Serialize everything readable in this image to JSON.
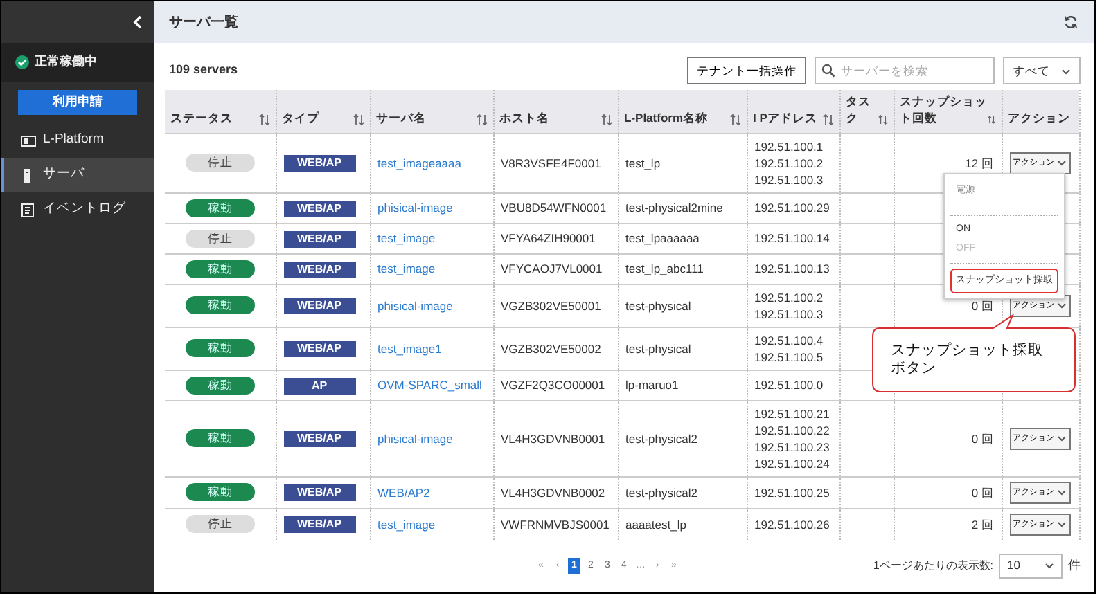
{
  "sidebar": {
    "status": {
      "label": "正常稼働中"
    },
    "request_button": "利用申請",
    "items": [
      {
        "label": "L-Platform",
        "kind": "platform",
        "selected": false
      },
      {
        "label": "サーバ",
        "kind": "server",
        "selected": true
      },
      {
        "label": "イベントログ",
        "kind": "log",
        "selected": false
      }
    ]
  },
  "header": {
    "title": "サーバ一覧"
  },
  "toolbar": {
    "count": "109 servers",
    "bulk_button": "テナント一括操作",
    "search": {
      "placeholder": "サーバーを検索"
    },
    "filter": "すべて"
  },
  "table": {
    "columns": [
      {
        "label": "ステータス",
        "sortable": true
      },
      {
        "label": "タイプ",
        "sortable": true
      },
      {
        "label": "サーバ名",
        "sortable": true
      },
      {
        "label": "ホスト名",
        "sortable": true
      },
      {
        "label": "L-Platform名称",
        "sortable": true
      },
      {
        "label": "I Pアドレス",
        "sortable": true
      },
      {
        "label": "タスク",
        "sortable": true
      },
      {
        "label": "スナップショット回数",
        "sortable": true
      },
      {
        "label": "アクション",
        "sortable": false
      }
    ],
    "rows": [
      {
        "status": {
          "label": "停止",
          "kind": "stopped"
        },
        "type": "WEB/AP",
        "server": "test_imageaaaa",
        "host": "V8R3VSFE4F0001",
        "lplatform": "test_lp",
        "ips": [
          "192.51.100.1",
          "192.51.100.2",
          "192.51.100.3"
        ],
        "snapshots": "12 回",
        "action": "アクション"
      },
      {
        "status": {
          "label": "稼動",
          "kind": "running"
        },
        "type": "WEB/AP",
        "server": "phisical-image",
        "host": "VBU8D54WFN0001",
        "lplatform": "test-physical2mine",
        "ips": [
          "192.51.100.29"
        ]
      },
      {
        "status": {
          "label": "停止",
          "kind": "stopped"
        },
        "type": "WEB/AP",
        "server": "test_image",
        "host": "VFYA64ZIH90001",
        "lplatform": "test_lpaaaaaa",
        "ips": [
          "192.51.100.14"
        ]
      },
      {
        "status": {
          "label": "稼動",
          "kind": "running"
        },
        "type": "WEB/AP",
        "server": "test_image",
        "host": "VFYCAOJ7VL0001",
        "lplatform": "test_lp_abc111",
        "ips": [
          "192.51.100.13"
        ]
      },
      {
        "status": {
          "label": "稼動",
          "kind": "running"
        },
        "type": "WEB/AP",
        "server": "phisical-image",
        "host": "VGZB302VE50001",
        "lplatform": "test-physical",
        "ips": [
          "192.51.100.2",
          "192.51.100.3"
        ],
        "snapshots": "0 回",
        "action": "アクション"
      },
      {
        "status": {
          "label": "稼動",
          "kind": "running"
        },
        "type": "WEB/AP",
        "server": "test_image1",
        "host": "VGZB302VE50002",
        "lplatform": "test-physical",
        "ips": [
          "192.51.100.4",
          "192.51.100.5"
        ]
      },
      {
        "status": {
          "label": "稼動",
          "kind": "running"
        },
        "type": "AP",
        "server": "OVM-SPARC_small",
        "host": "VGZF2Q3CO00001",
        "lplatform": "lp-maruo1",
        "ips": [
          "192.51.100.0"
        ]
      },
      {
        "status": {
          "label": "稼動",
          "kind": "running"
        },
        "type": "WEB/AP",
        "server": "phisical-image",
        "host": "VL4H3GDVNB0001",
        "lplatform": "test-physical2",
        "ips": [
          "192.51.100.21",
          "192.51.100.22",
          "192.51.100.23",
          "192.51.100.24"
        ],
        "snapshots": "0 回",
        "action": "アクション"
      },
      {
        "status": {
          "label": "稼動",
          "kind": "running"
        },
        "type": "WEB/AP",
        "server": "WEB/AP2",
        "host": "VL4H3GDVNB0002",
        "lplatform": "test-physical2",
        "ips": [
          "192.51.100.25"
        ],
        "snapshots": "0 回",
        "action": "アクション"
      },
      {
        "status": {
          "label": "停止",
          "kind": "stopped"
        },
        "type": "WEB/AP",
        "server": "test_image",
        "host": "VWFRNMVBJS0001",
        "lplatform": "aaaatest_lp",
        "ips": [
          "192.51.100.26"
        ],
        "snapshots": "2 回",
        "action": "アクション"
      }
    ]
  },
  "action_menu": {
    "items": [
      {
        "label": "電源",
        "kind": "header"
      },
      {
        "kind": "divider"
      },
      {
        "label": "ON",
        "kind": "item",
        "disabled": false,
        "highlighted": false
      },
      {
        "label": "OFF",
        "kind": "item",
        "disabled": true,
        "highlighted": false
      },
      {
        "kind": "divider"
      },
      {
        "label": "スナップショット採取",
        "kind": "item",
        "disabled": false,
        "highlighted": true
      }
    ]
  },
  "callout": {
    "lines": [
      "スナップショット採取",
      "ボタン"
    ]
  },
  "pagination": {
    "pages": [
      {
        "label": "«",
        "kind": "nav",
        "selected": false
      },
      {
        "label": "‹",
        "kind": "nav",
        "selected": false
      },
      {
        "label": "1",
        "kind": "page",
        "selected": true
      },
      {
        "label": "2",
        "kind": "page",
        "selected": false
      },
      {
        "label": "3",
        "kind": "page",
        "selected": false
      },
      {
        "label": "4",
        "kind": "page",
        "selected": false
      },
      {
        "label": "…",
        "kind": "nav",
        "selected": false
      },
      {
        "label": "›",
        "kind": "nav",
        "selected": false
      },
      {
        "label": "»",
        "kind": "nav",
        "selected": false
      }
    ],
    "per_page_label": "1ページあたりの表示数:",
    "per_page": "10",
    "unit": "件"
  }
}
